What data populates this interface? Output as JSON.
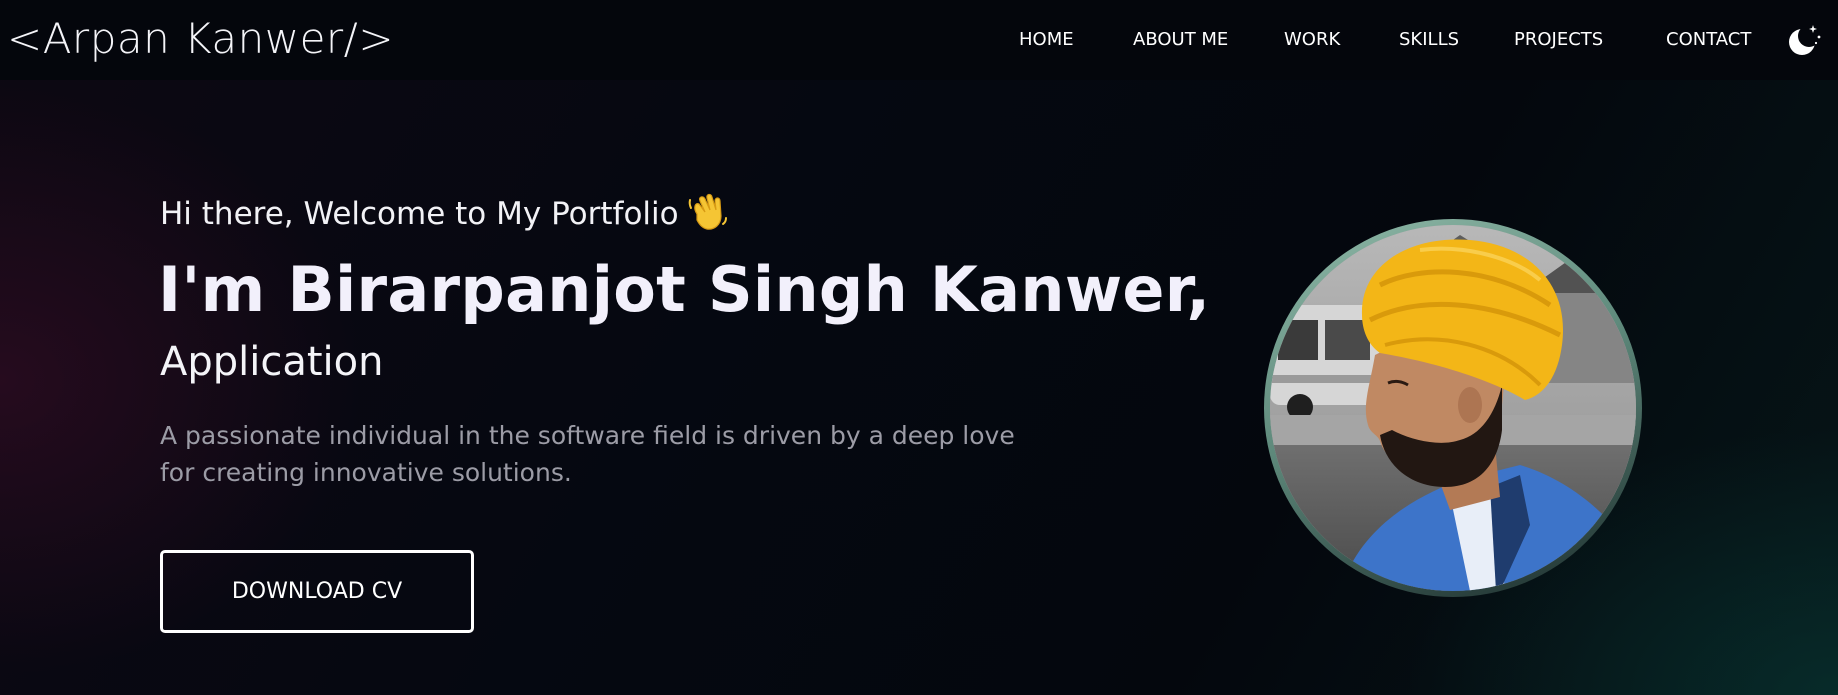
{
  "navbar": {
    "logo": "<Arpan Kanwer/>",
    "links": [
      {
        "label": "HOME"
      },
      {
        "label": "ABOUT ME"
      },
      {
        "label": "WORK"
      },
      {
        "label": "SKILLS"
      },
      {
        "label": "PROJECTS"
      },
      {
        "label": "CONTACT"
      }
    ],
    "theme_toggle_icon": "moon-stars-icon"
  },
  "hero": {
    "greeting": "Hi there, Welcome to My Portfolio",
    "greeting_icon": "waving-hand-icon",
    "title": "I'm Birarpanjot Singh Kanwer,",
    "role": "Application",
    "description": "A passionate individual in the software field is driven by a deep love for creating innovative solutions.",
    "download_label": "DOWNLOAD CV"
  },
  "profile_image": {
    "icon": "profile-photo-icon"
  },
  "colors": {
    "background": "#04060c",
    "text": "#f2f0fb",
    "muted_text": "#9c9ca6",
    "avatar_ring": "#8fb9a8",
    "turban": "#f3b617",
    "jacket": "#3d74c9"
  }
}
